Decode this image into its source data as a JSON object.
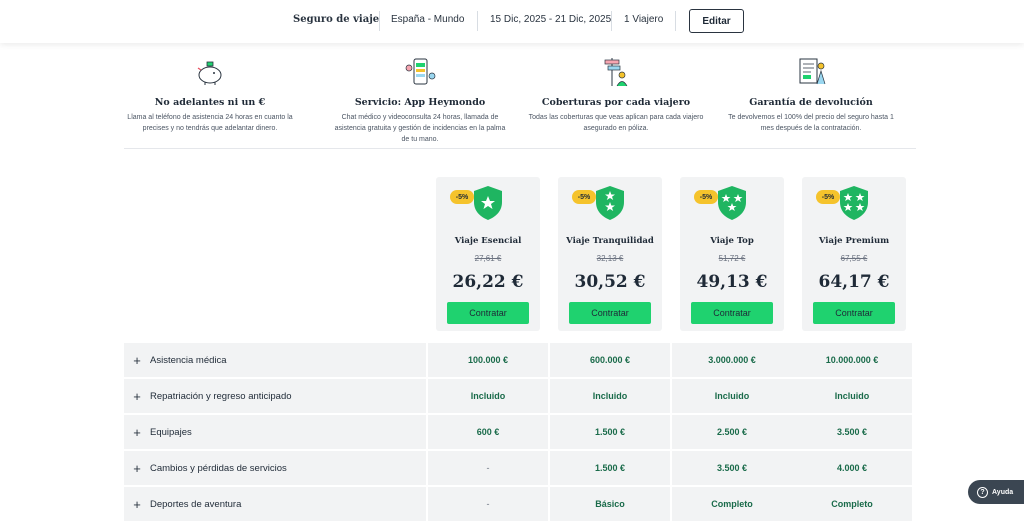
{
  "search_bar": {
    "title": "Seguro de viaje",
    "destination": "España - Mundo",
    "dates": "15 Dic, 2025 - 21 Dic, 2025",
    "travelers": "1 Viajero",
    "edit_label": "Editar"
  },
  "benefits": [
    {
      "title": "No adelantes ni un €",
      "description": "Llama al teléfono de asistencia 24 horas en cuanto la precises y no tendrás que adelantar dinero.",
      "icon": "piggy-bank-icon"
    },
    {
      "title": "Servicio: App Heymondo",
      "description": "Chat médico y videoconsulta 24 horas, llamada de asistencia gratuita y gestión de incidencias en la palma de tu mano.",
      "icon": "mobile-app-icon"
    },
    {
      "title": "Coberturas por cada viajero",
      "description": "Todas las coberturas que veas aplican para cada viajero asegurado en póliza.",
      "icon": "travelers-icon"
    },
    {
      "title": "Garantía de devolución",
      "description": "Te devolvemos el 100% del precio del seguro hasta 1 mes después de la contratación.",
      "icon": "refund-document-icon"
    }
  ],
  "plans": [
    {
      "name": "Viaje Esencial",
      "discount": "-5%",
      "old_price": "27,61 €",
      "price": "26,22 €",
      "stars": 1,
      "cta": "Contratar"
    },
    {
      "name": "Viaje Tranquilidad",
      "discount": "-5%",
      "old_price": "32,13 €",
      "price": "30,52 €",
      "stars": 2,
      "cta": "Contratar"
    },
    {
      "name": "Viaje Top",
      "discount": "-5%",
      "old_price": "51,72 €",
      "price": "49,13 €",
      "stars": 3,
      "cta": "Contratar"
    },
    {
      "name": "Viaje Premium",
      "discount": "-5%",
      "old_price": "67,55 €",
      "price": "64,17 €",
      "stars": 4,
      "cta": "Contratar"
    }
  ],
  "coverages": [
    {
      "label": "Asistencia médica",
      "values": [
        "100.000 €",
        "600.000 €",
        "3.000.000 €",
        "10.000.000 €"
      ]
    },
    {
      "label": "Repatriación y regreso anticipado",
      "values": [
        "Incluido",
        "Incluido",
        "Incluido",
        "Incluido"
      ]
    },
    {
      "label": "Equipajes",
      "values": [
        "600 €",
        "1.500 €",
        "2.500 €",
        "3.500 €"
      ]
    },
    {
      "label": "Cambios y pérdidas de servicios",
      "values": [
        "-",
        "1.500 €",
        "3.500 €",
        "4.000 €"
      ]
    },
    {
      "label": "Deportes de aventura",
      "values": [
        "-",
        "Básico",
        "Completo",
        "Completo"
      ]
    }
  ],
  "help": {
    "label": "Ayuda"
  },
  "colors": {
    "accent_green": "#1fd26f",
    "value_green": "#1a6b4a",
    "badge_yellow": "#f5c32c",
    "shield_green": "#1fb561"
  }
}
